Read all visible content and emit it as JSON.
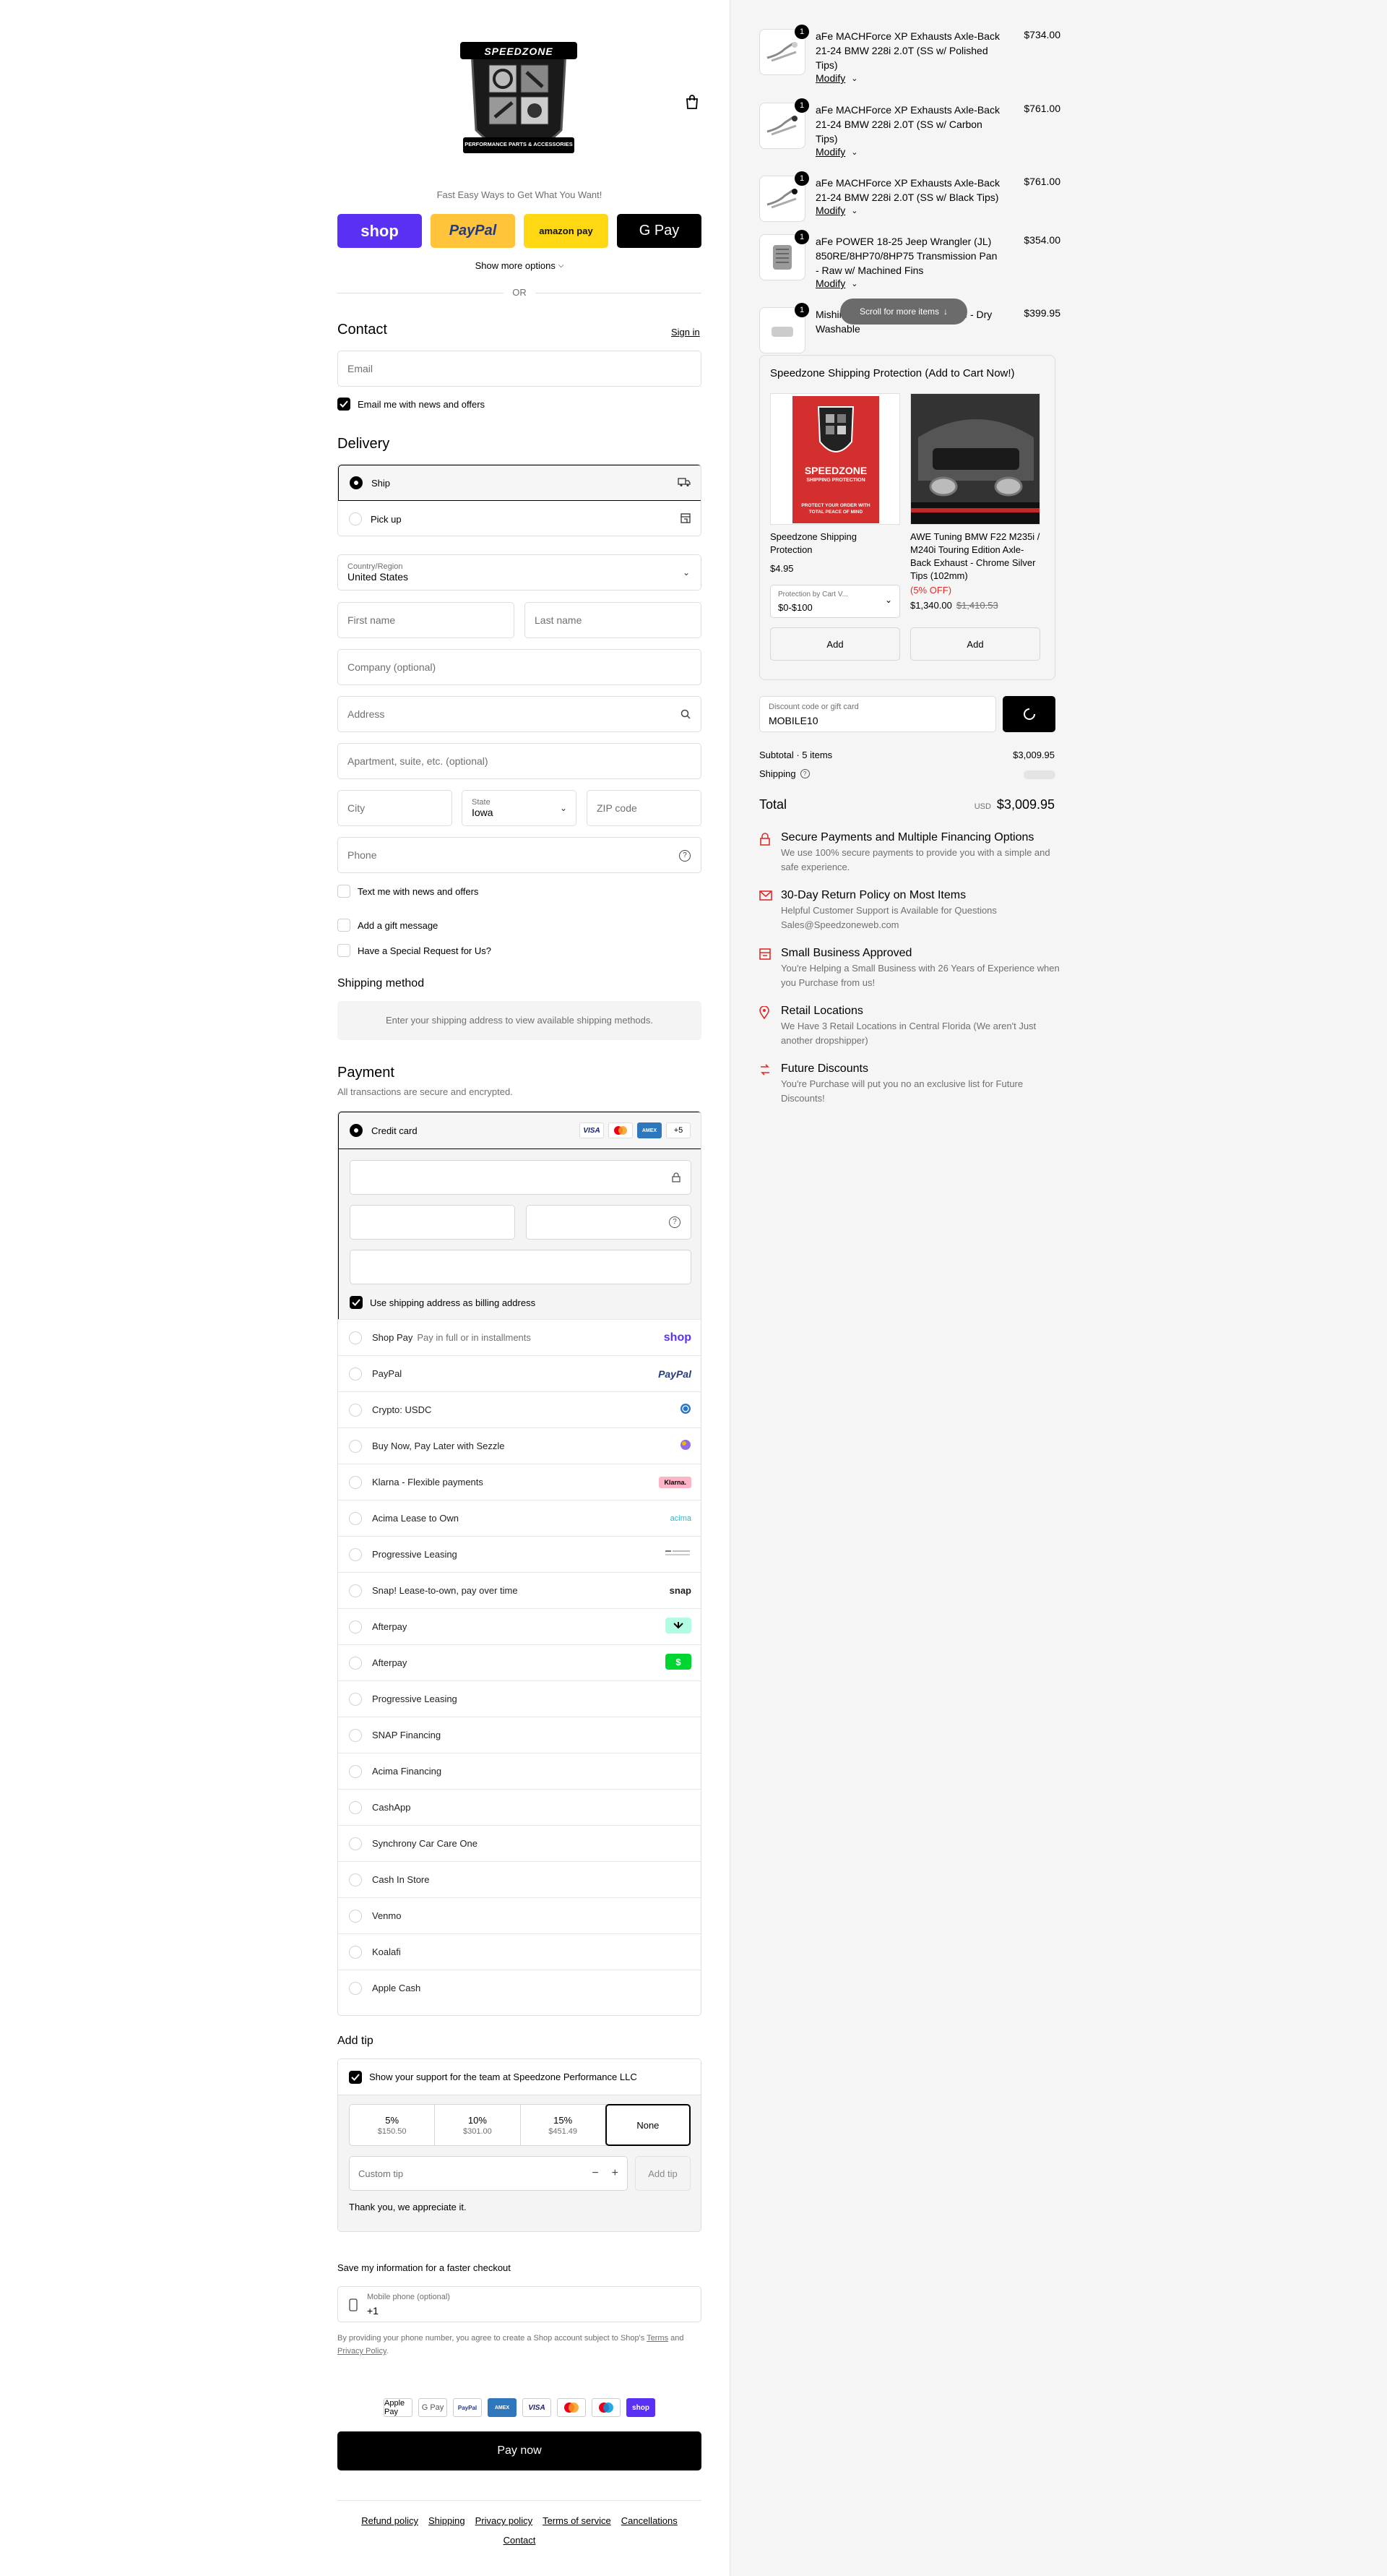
{
  "store": {
    "name": "SPEEDZONE",
    "logo_tagline": "PERFORMANCE PARTS & ACCESSORIES"
  },
  "express": {
    "title": "Fast Easy Ways to Get What You Want!",
    "buttons": [
      {
        "label": "shop"
      },
      {
        "label": "PayPal"
      },
      {
        "label": "amazon pay"
      },
      {
        "label": "G Pay"
      }
    ],
    "more": "Show more options",
    "or": "OR"
  },
  "contact": {
    "title": "Contact",
    "signin": "Sign in",
    "email_placeholder": "Email",
    "news_label": "Email me with news and offers"
  },
  "delivery": {
    "title": "Delivery",
    "options": [
      {
        "label": "Ship"
      },
      {
        "label": "Pick up"
      }
    ],
    "country_label": "Country/Region",
    "country_value": "United States",
    "first_name": "First name",
    "last_name": "Last name",
    "company": "Company (optional)",
    "address": "Address",
    "apartment": "Apartment, suite, etc. (optional)",
    "city": "City",
    "state_label": "State",
    "state_value": "Iowa",
    "zip": "ZIP code",
    "phone": "Phone",
    "text_label": "Text me with news and offers",
    "gift_label": "Add a gift message",
    "special_label": "Have a Special Request for Us?"
  },
  "shipping_method": {
    "title": "Shipping method",
    "message": "Enter your shipping address to view available shipping methods."
  },
  "payment": {
    "title": "Payment",
    "subtitle": "All transactions are secure and encrypted.",
    "credit_card": "Credit card",
    "more_cards": "+5",
    "billing_label": "Use shipping address as billing address",
    "shoppay_label": "Shop Pay",
    "shoppay_sub": "Pay in full or in installments",
    "methods": [
      "PayPal",
      "Crypto: USDC",
      "Buy Now, Pay Later with Sezzle",
      "Klarna - Flexible payments",
      "Acima Lease to Own",
      "Progressive Leasing",
      "Snap! Lease-to-own, pay over time",
      "Afterpay",
      "Afterpay",
      "Progressive Leasing",
      "SNAP Financing",
      "Acima Financing",
      "CashApp",
      "Synchrony Car Care One",
      "Cash In Store",
      "Venmo",
      "Koalafi",
      "Apple Cash"
    ],
    "logos": {
      "paypal": "PayPal",
      "klarna": "Klarna.",
      "acima": "acima",
      "snap": "snap",
      "shop": "shop"
    }
  },
  "tip": {
    "title": "Add tip",
    "support_label": "Show your support for the team at Speedzone Performance LLC",
    "options": [
      {
        "pct": "5%",
        "amt": "$150.50"
      },
      {
        "pct": "10%",
        "amt": "$301.00"
      },
      {
        "pct": "15%",
        "amt": "$451.49"
      },
      {
        "pct": "None",
        "amt": ""
      }
    ],
    "custom_placeholder": "Custom tip",
    "add_label": "Add tip",
    "thanks": "Thank you, we appreciate it."
  },
  "save": {
    "title": "Save my information for a faster checkout",
    "phone_label": "Mobile phone (optional)",
    "phone_value": "+1",
    "legal_pre": "By providing your phone number, you agree to create a Shop account subject to Shop's",
    "terms": "Terms",
    "and": "and",
    "privacy": "Privacy Policy",
    "period": "."
  },
  "footer_pay_icons": [
    "Apple Pay",
    "G Pay",
    "PayPal",
    "AMEX",
    "VISA",
    "Mastercard",
    "Maestro",
    "shop"
  ],
  "pay_now": "Pay now",
  "footer_links": [
    "Refund policy",
    "Shipping",
    "Privacy policy",
    "Terms of service",
    "Cancellations",
    "Contact"
  ],
  "cart": {
    "items": [
      {
        "qty": "1",
        "name": "aFe MACHForce XP Exhausts Axle-Back 21-24 BMW 228i 2.0T (SS w/ Polished Tips)",
        "price": "$734.00",
        "modify": "Modify"
      },
      {
        "qty": "1",
        "name": "aFe MACHForce XP Exhausts Axle-Back 21-24 BMW 228i 2.0T (SS w/ Carbon Tips)",
        "price": "$761.00",
        "modify": "Modify"
      },
      {
        "qty": "1",
        "name": "aFe MACHForce XP Exhausts Axle-Back 21-24 BMW 228i 2.0T (SS w/ Black Tips)",
        "price": "$761.00",
        "modify": "Modify"
      },
      {
        "qty": "1",
        "name": "aFe POWER 18-25 Jeep Wrangler (JL) 850RE/8HP70/8HP75 Transmission Pan - Raw w/ Machined Fins",
        "price": "$354.00",
        "modify": "Modify"
      },
      {
        "qty": "1",
        "name": "Mishimoto Performance Air Intake - Dry Washable",
        "price": "$399.95",
        "modify": ""
      }
    ],
    "scroll_hint": "Scroll for more items",
    "upsell": {
      "title": "Speedzone Shipping Protection (Add to Cart Now!)",
      "products": [
        {
          "name": "Speedzone Shipping Protection",
          "price": "$4.95",
          "select_label": "Protection by Cart V...",
          "select_value": "$0-$100",
          "add": "Add",
          "img_title": "SPEEDZONE",
          "img_sub": "SHIPPING PROTECTION",
          "img_foot": "PROTECT YOUR ORDER WITH TOTAL PEACE OF MIND"
        },
        {
          "name": "AWE Tuning BMW F22 M235i / M240i Touring Edition Axle-Back Exhaust - Chrome Silver Tips (102mm)",
          "discount": "(5% OFF)",
          "price": "$1,340.00",
          "compare": "$1,410.53",
          "add": "Add"
        }
      ]
    },
    "discount_label": "Discount code or gift card",
    "discount_value": "MOBILE10",
    "subtotal_label": "Subtotal · 5 items",
    "subtotal_value": "$3,009.95",
    "shipping_label": "Shipping",
    "total_label": "Total",
    "currency": "USD",
    "total_value": "$3,009.95"
  },
  "features": [
    {
      "title": "Secure Payments and Multiple Financing Options",
      "desc": "We use 100% secure payments to provide you with a simple and safe experience."
    },
    {
      "title": "30-Day Return Policy on Most Items",
      "desc": "Helpful Customer Support is Available for Questions Sales@Speedzoneweb.com"
    },
    {
      "title": "Small Business Approved",
      "desc": "You're Helping a Small Business with 26 Years of Experience when you Purchase from us!"
    },
    {
      "title": "Retail Locations",
      "desc": "We Have 3 Retail Locations in Central Florida (We aren't Just another dropshipper)"
    },
    {
      "title": "Future Discounts",
      "desc": "You're Purchase will put you no an exclusive list for Future Discounts!"
    }
  ],
  "colors": {
    "accent": "#000000",
    "shop": "#5a31f4",
    "paypal": "#ffc439",
    "amazon": "#ffd814",
    "red": "#e22b2b",
    "muted": "#707070"
  }
}
